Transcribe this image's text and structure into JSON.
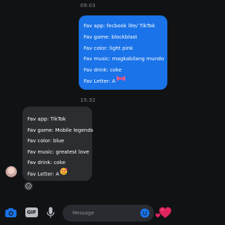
{
  "thread": {
    "timestamp_1": "09:03",
    "timestamp_2": "15:32"
  },
  "outgoing": {
    "lines": [
      "Fav app: fecbook lite/ TikTok",
      "Fav game: blockblast",
      "Fav color: light pink",
      "Fav music: magkabilang mundo",
      "Fav drink: coke",
      "Fav Letter: A"
    ],
    "trailing_emoji": "pink-bow-emoji",
    "bubble_color": "#1a73e8"
  },
  "incoming": {
    "lines": [
      "Fav app: TikTok",
      "Fav game: Mobile legends",
      "Fav color: blue",
      "Fav music: greatest love",
      "Fav drink: coke",
      "Fav Letter: A"
    ],
    "trailing_emoji": "heart-face-emoji",
    "bubble_color": "#2c2d31"
  },
  "composer": {
    "placeholder": "Message",
    "gif_label": "GIF",
    "accent_color": "#1a73e8",
    "like_color": "#e0245e"
  }
}
